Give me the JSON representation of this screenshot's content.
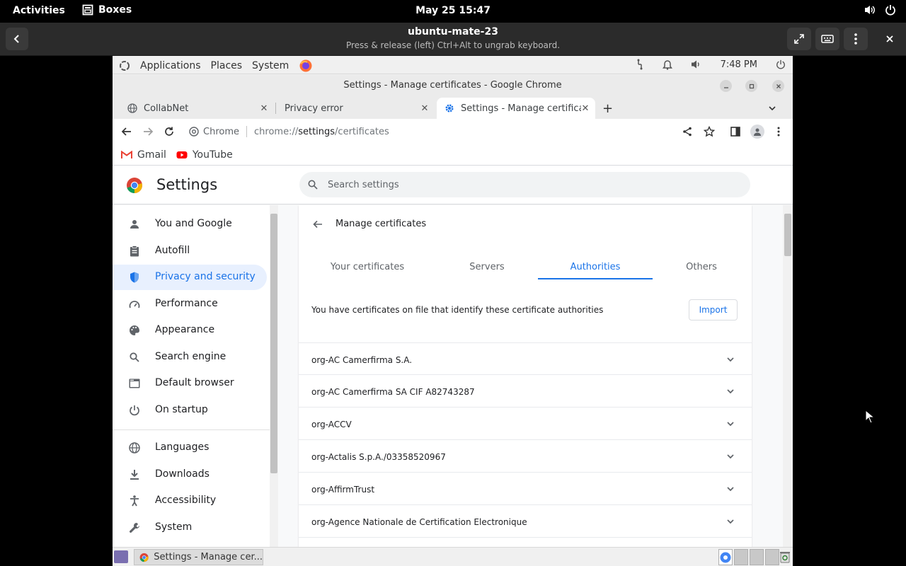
{
  "gnome": {
    "activities": "Activities",
    "app_name": "Boxes",
    "clock": "May 25  15:47"
  },
  "boxes": {
    "title": "ubuntu-mate-23",
    "subtitle": "Press & release (left) Ctrl+Alt to ungrab keyboard."
  },
  "mate_panel": {
    "applications": "Applications",
    "places": "Places",
    "system": "System",
    "time": "7:48 PM"
  },
  "chrome": {
    "window_title": "Settings - Manage certificates - Google Chrome",
    "tabs": [
      {
        "label": "CollabNet"
      },
      {
        "label": "Privacy error"
      },
      {
        "label": "Settings - Manage certificates"
      }
    ],
    "omnibox": {
      "chip": "Chrome",
      "url_scheme": "chrome://",
      "url_host": "settings",
      "url_path": "/certificates"
    },
    "bookmarks": [
      {
        "label": "Gmail"
      },
      {
        "label": "YouTube"
      }
    ]
  },
  "settings": {
    "title": "Settings",
    "search_placeholder": "Search settings",
    "sidebar": [
      {
        "label": "You and Google",
        "icon": "person-icon"
      },
      {
        "label": "Autofill",
        "icon": "clipboard-icon"
      },
      {
        "label": "Privacy and security",
        "icon": "shield-icon"
      },
      {
        "label": "Performance",
        "icon": "speedometer-icon"
      },
      {
        "label": "Appearance",
        "icon": "palette-icon"
      },
      {
        "label": "Search engine",
        "icon": "search-icon"
      },
      {
        "label": "Default browser",
        "icon": "browser-icon"
      },
      {
        "label": "On startup",
        "icon": "power-icon"
      },
      {
        "label": "Languages",
        "icon": "globe-icon"
      },
      {
        "label": "Downloads",
        "icon": "download-icon"
      },
      {
        "label": "Accessibility",
        "icon": "accessibility-icon"
      },
      {
        "label": "System",
        "icon": "wrench-icon"
      }
    ],
    "page_title": "Manage certificates",
    "cert_tabs": [
      {
        "label": "Your certificates"
      },
      {
        "label": "Servers"
      },
      {
        "label": "Authorities"
      },
      {
        "label": "Others"
      }
    ],
    "description": "You have certificates on file that identify these certificate authorities",
    "import_label": "Import",
    "certificates": [
      {
        "name": "org-AC Camerfirma S.A."
      },
      {
        "name": "org-AC Camerfirma SA CIF A82743287"
      },
      {
        "name": "org-ACCV"
      },
      {
        "name": "org-Actalis S.p.A./03358520967"
      },
      {
        "name": "org-AffirmTrust"
      },
      {
        "name": "org-Agence Nationale de Certification Electronique"
      }
    ]
  },
  "taskbar": {
    "task_label": "Settings - Manage cer..."
  },
  "colors": {
    "accent": "#1a73e8",
    "active_bg": "#e8f0fe"
  }
}
